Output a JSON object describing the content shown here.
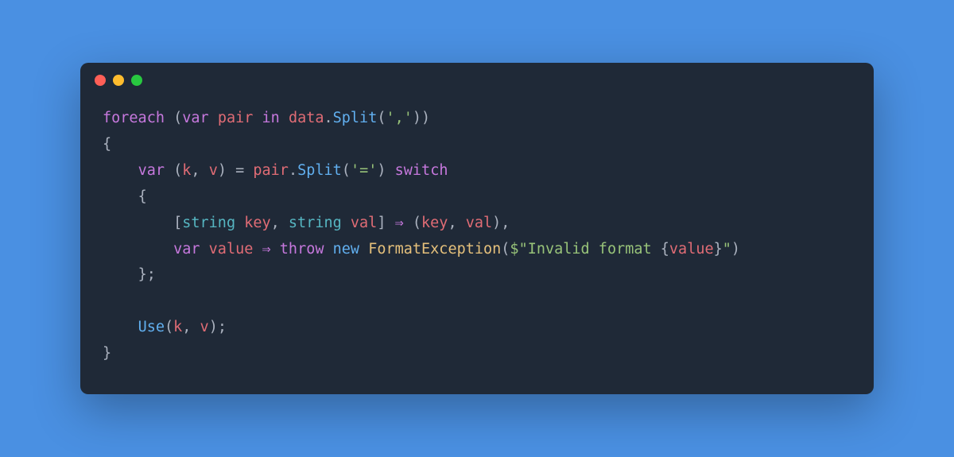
{
  "colors": {
    "background": "#4a90e2",
    "window_bg": "#1f2937",
    "traffic_red": "#ff5f57",
    "traffic_yellow": "#febc2e",
    "traffic_green": "#28c840",
    "keyword": "#c678dd",
    "type": "#56b6c2",
    "function": "#61afef",
    "string": "#98c379",
    "identifier": "#e06c75",
    "class": "#e5c07b",
    "default_text": "#abb2bf"
  },
  "code": {
    "language": "csharp",
    "tokens": {
      "kw_foreach": "foreach",
      "paren_open": "(",
      "kw_var": "var",
      "id_pair": "pair",
      "kw_in": "in",
      "id_data": "data",
      "dot1": ".",
      "fn_split1": "Split",
      "paren_open2": "(",
      "str_comma": "','",
      "paren_close2": ")",
      "paren_close": ")",
      "brace_open": "{",
      "kw_var2": "var",
      "paren_open3": "(",
      "id_k": "k",
      "comma1": ", ",
      "id_v": "v",
      "paren_close3": ")",
      "eq": " = ",
      "id_pair2": "pair",
      "dot2": ".",
      "fn_split2": "Split",
      "paren_open4": "(",
      "str_eq": "'='",
      "paren_close4": ")",
      "kw_switch": "switch",
      "brace_open2": "{",
      "bracket_open": "[",
      "type_string1": "string",
      "id_key": "key",
      "comma2": ", ",
      "type_string2": "string",
      "id_val": "val",
      "bracket_close": "]",
      "arrow1": " ⇒ ",
      "paren_open5": "(",
      "id_key2": "key",
      "comma3": ", ",
      "id_val2": "val",
      "paren_close5": ")",
      "comma4": ",",
      "kw_var3": "var",
      "id_value": "value",
      "arrow2": " ⇒ ",
      "kw_throw": "throw",
      "kw_new": "new",
      "cls_formatexception": "FormatException",
      "paren_open6": "(",
      "str_dollar": "$",
      "str_invalid_open": "\"Invalid format ",
      "interp_open": "{",
      "id_value2": "value",
      "interp_close": "}",
      "str_invalid_close": "\"",
      "paren_close6": ")",
      "brace_close2": "}",
      "semi1": ";",
      "fn_use": "Use",
      "paren_open7": "(",
      "id_k2": "k",
      "comma5": ", ",
      "id_v2": "v",
      "paren_close7": ")",
      "semi2": ";",
      "brace_close": "}"
    }
  }
}
